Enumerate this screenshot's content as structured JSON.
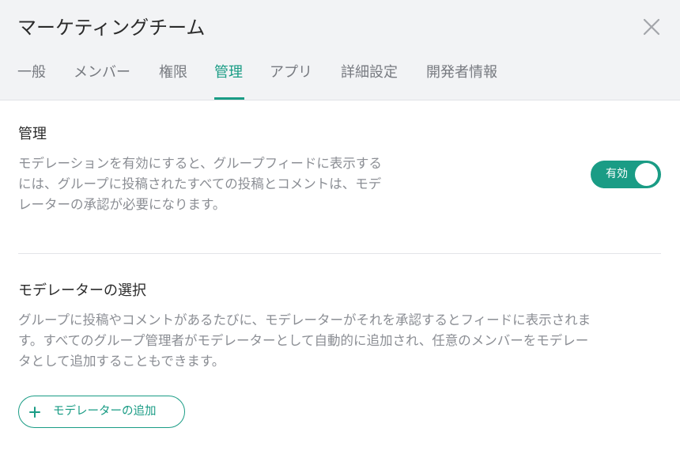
{
  "dialog": {
    "title": "マーケティングチーム",
    "close_icon": "close-icon"
  },
  "tabs": [
    {
      "label": "一般",
      "active": false
    },
    {
      "label": "メンバー",
      "active": false
    },
    {
      "label": "権限",
      "active": false
    },
    {
      "label": "管理",
      "active": true
    },
    {
      "label": "アプリ",
      "active": false
    },
    {
      "label": "詳細設定",
      "active": false
    },
    {
      "label": "開発者情報",
      "active": false
    }
  ],
  "moderation": {
    "title": "管理",
    "description_lines": [
      "モデレーションを有効にすると、グループフィードに表示する",
      "には、グループに投稿されたすべての投稿とコメントは、モデ",
      "レーターの承認が必要になります。"
    ],
    "toggle_label": "有効",
    "toggle_on": true
  },
  "moderators": {
    "title": "モデレーターの選択",
    "description_lines": [
      "グループに投稿やコメントがあるたびに、モデレーターがそれを承認するとフィードに表示されま",
      "す。すべてのグループ管理者がモデレーターとして自動的に追加され、任意のメンバーをモデレー",
      "タとして追加することもできます。"
    ],
    "add_button_icon": "plus-icon",
    "add_button_label": "モデレーターの追加"
  },
  "colors": {
    "accent": "#1a9c85",
    "header_bg": "#f2f3f5",
    "muted_text": "#8b8e94"
  }
}
